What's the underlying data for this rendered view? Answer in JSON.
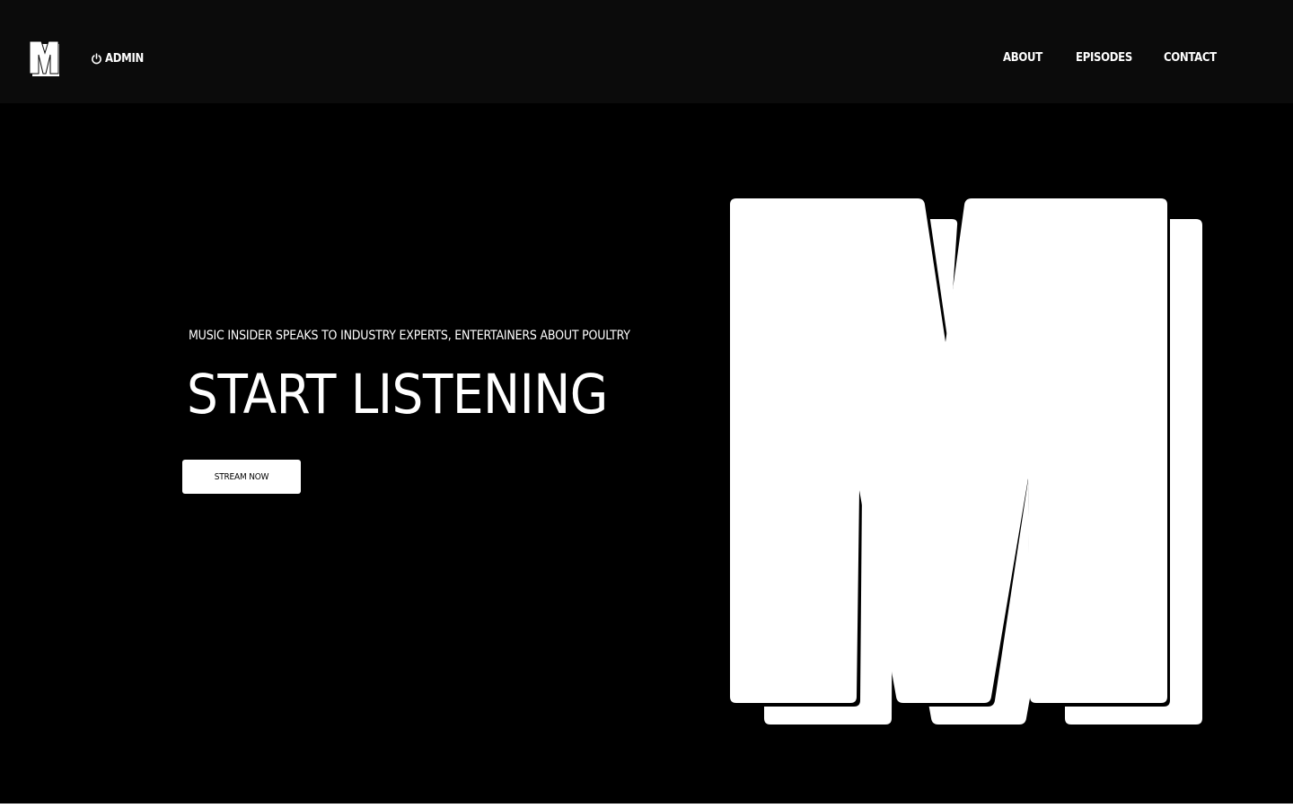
{
  "header": {
    "logo_alt": "M",
    "admin_label": "ADMIN",
    "nav": [
      {
        "label": "ABOUT"
      },
      {
        "label": "EPISODES"
      },
      {
        "label": "CONTACT"
      }
    ]
  },
  "hero": {
    "tagline": "MUSIC INSIDER SPEAKS TO INDUSTRY EXPERTS, ENTERTAINERS ABOUT POULTRY",
    "headline": "START LISTENING",
    "cta_label": "STREAM NOW"
  },
  "colors": {
    "background": "#000000",
    "header_background": "#0b0b0b",
    "foreground": "#ffffff"
  }
}
